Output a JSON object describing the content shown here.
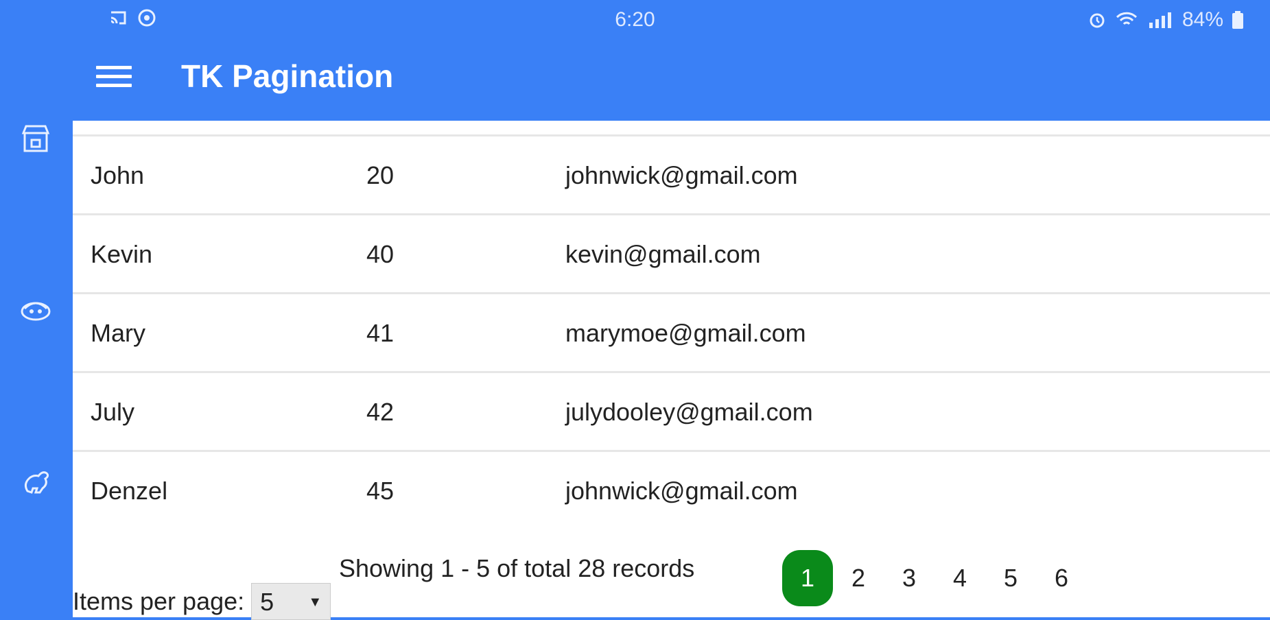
{
  "status": {
    "time": "6:20",
    "battery": "84%"
  },
  "app": {
    "title": "TK Pagination"
  },
  "table": {
    "rows": [
      {
        "name": "John",
        "age": "20",
        "email": "johnwick@gmail.com"
      },
      {
        "name": "Kevin",
        "age": "40",
        "email": "kevin@gmail.com"
      },
      {
        "name": "Mary",
        "age": "41",
        "email": "marymoe@gmail.com"
      },
      {
        "name": "July",
        "age": "42",
        "email": "julydooley@gmail.com"
      },
      {
        "name": "Denzel",
        "age": "45",
        "email": "johnwick@gmail.com"
      }
    ]
  },
  "footer": {
    "showing_text": "Showing 1 - 5 of total 28 records",
    "items_per_page_label": "Items per page:",
    "items_per_page_value": "5",
    "pages": [
      "1",
      "2",
      "3",
      "4",
      "5",
      "6"
    ],
    "active_page": "1"
  },
  "colors": {
    "primary": "#3a80f6",
    "active_page": "#0a8a1a"
  },
  "icons": {
    "menu": "hamburger-menu-icon",
    "rail": [
      "store-icon",
      "cake-icon",
      "dinosaur-icon"
    ]
  }
}
